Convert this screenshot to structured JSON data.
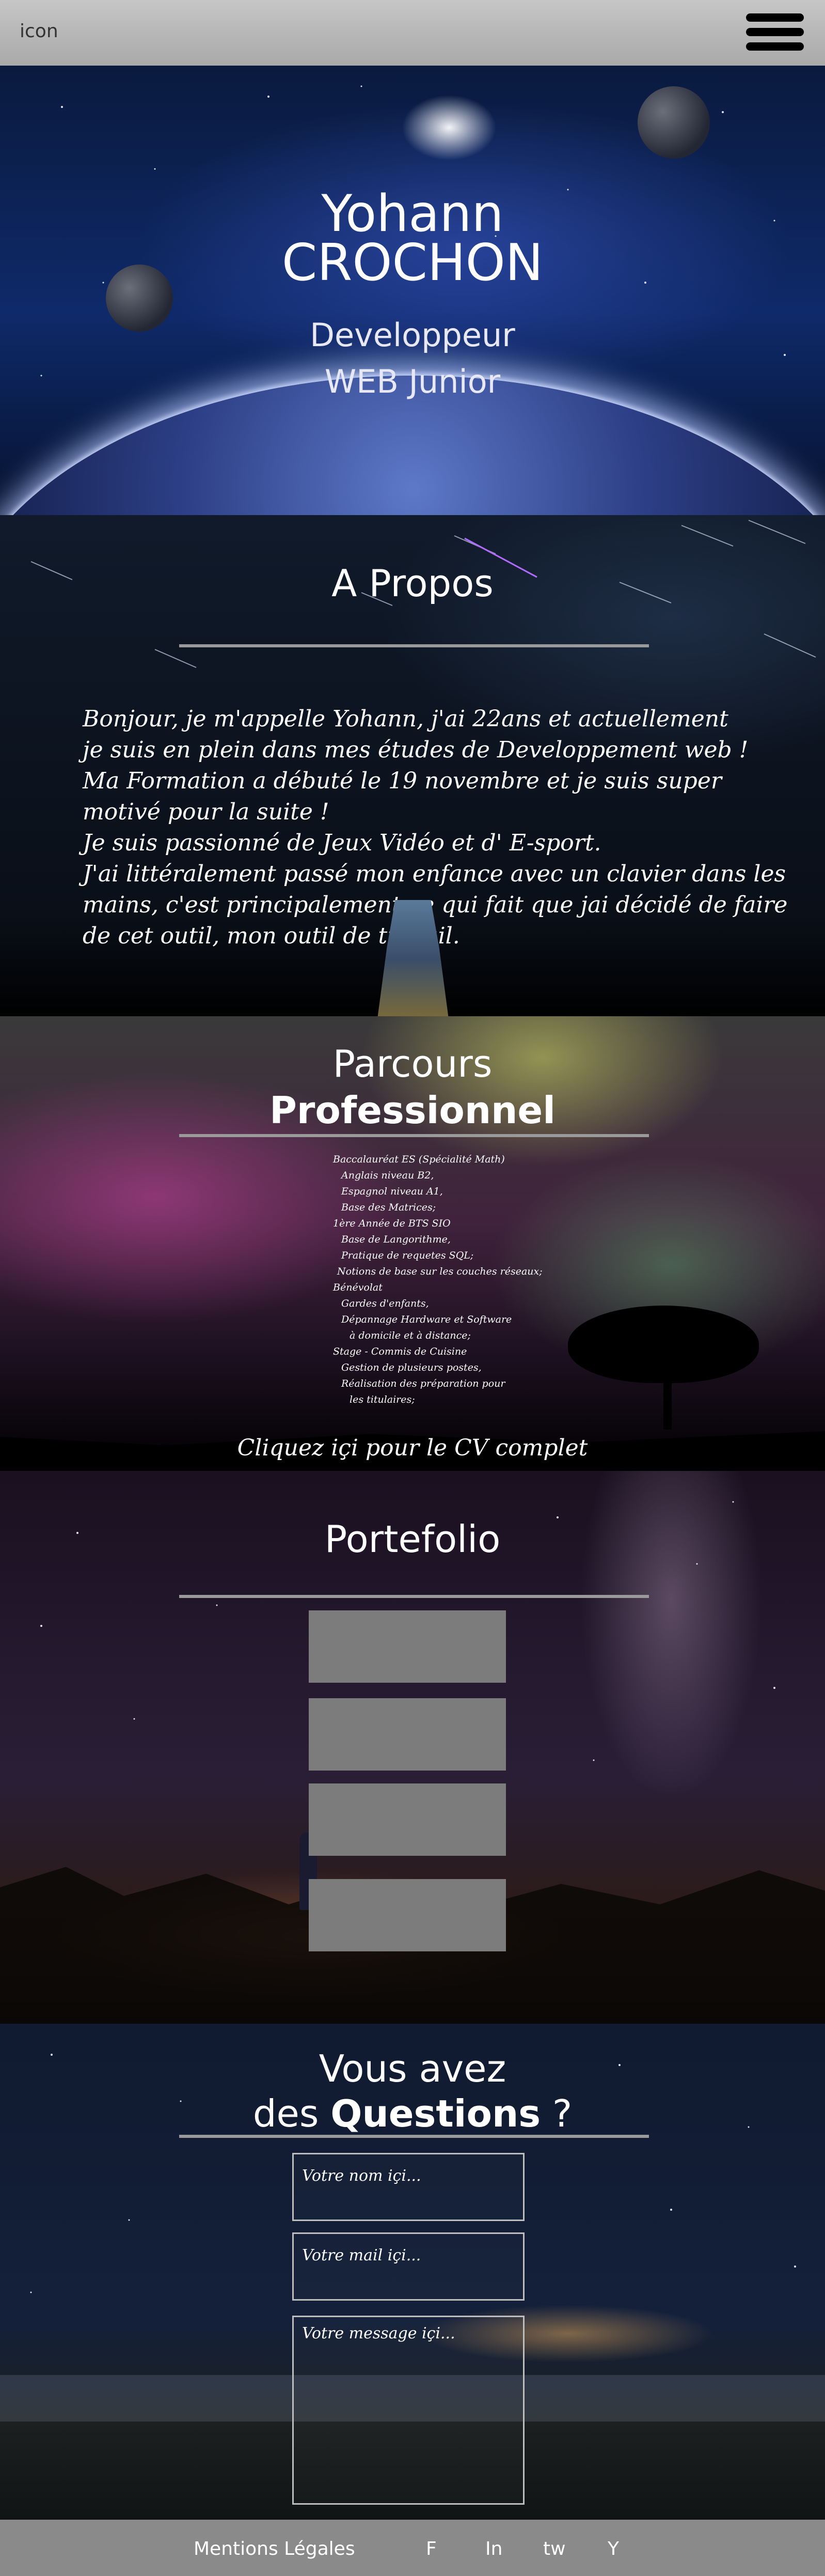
{
  "header": {
    "logo_text": "icon",
    "menu_icon": "hamburger-menu-icon"
  },
  "hero": {
    "first_name": "Yohann",
    "last_name": "CROCHON",
    "job_line1": "Developpeur",
    "job_line2": "WEB Junior"
  },
  "about": {
    "title": "A Propos",
    "lines": [
      "Bonjour, je m'appelle Yohann, j'ai 22ans et actuellement",
      "je suis en plein dans mes études de Developpement web !",
      "Ma Formation a débuté le 19 novembre et je suis super",
      "motivé pour la suite !",
      "Je suis passionné de Jeux Vidéo et d' E-sport.",
      "J'ai littéralement passé mon enfance avec un clavier dans les",
      "mains, c'est principalement ce qui fait que jai décidé de faire",
      "de cet outil, mon outil de travail."
    ]
  },
  "career": {
    "title_line1": "Parcours",
    "title_line2": "Professionnel",
    "items": [
      "Baccalauréat ES (Spécialité Math)",
      "Anglais niveau B2,",
      "Espagnol niveau A1,",
      "Base des Matrices;",
      "1ère Année de BTS SIO",
      "Base de Langorithme,",
      "Pratique de requetes SQL;",
      "Notions de base sur les couches réseaux;",
      "Bénévolat",
      "Gardes d'enfants,",
      "Dépannage Hardware et Software",
      "à domicile et à distance;",
      "Stage - Commis de Cuisine",
      "Gestion de plusieurs postes,",
      "Réalisation des préparation pour",
      "les titulaires;"
    ],
    "cv_link": "Cliquez içi pour le CV complet"
  },
  "portfolio": {
    "title": "Portefolio"
  },
  "contact": {
    "title_line1": "Vous avez",
    "title_prefix": "des",
    "title_bold": "Questions",
    "title_suffix": "?",
    "name_placeholder": "Votre nom içi...",
    "mail_placeholder": "Votre mail içi...",
    "message_placeholder": "Votre message içi..."
  },
  "footer": {
    "legal": "Mentions Légales",
    "social": [
      "F",
      "In",
      "tw",
      "Y"
    ]
  }
}
